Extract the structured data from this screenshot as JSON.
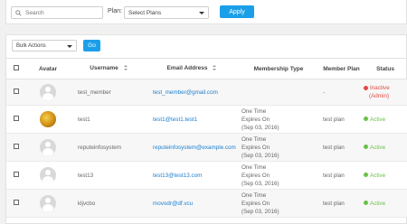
{
  "filter": {
    "search_placeholder": "Search",
    "plan_label": "Plan:",
    "plan_select_value": "Select Plans",
    "apply_label": "Apply"
  },
  "bulk": {
    "select_value": "Bulk Actions",
    "go_label": "Go"
  },
  "table": {
    "headers": {
      "avatar": "Avatar",
      "username": "Username",
      "email": "Email Address",
      "membership_type": "Membership Type",
      "member_plan": "Member Plan",
      "status": "Status"
    },
    "rows": [
      {
        "username": "test_member",
        "email": "test_member@gmail.com",
        "type_line1": "",
        "type_line2": "",
        "type_line3": "",
        "plan": "-",
        "status": "Inactive",
        "status_line2": "(Admin)"
      },
      {
        "username": "test1",
        "email": "test1@test1.test1",
        "type_line1": "One Time",
        "type_line2": "Expires On",
        "type_line3": "(Sep 03, 2016)",
        "plan": "test plan",
        "status": "Active",
        "status_line2": ""
      },
      {
        "username": "reputeinfosystem",
        "email": "reputeinfosystem@example.com",
        "type_line1": "One Time",
        "type_line2": "Expires On",
        "type_line3": "(Sep 03, 2016)",
        "plan": "test plan",
        "status": "Active",
        "status_line2": ""
      },
      {
        "username": "test13",
        "email": "test13@test13.com",
        "type_line1": "One Time",
        "type_line2": "Expires On",
        "type_line3": "(Sep 03, 2016)",
        "plan": "test plan",
        "status": "Active",
        "status_line2": ""
      },
      {
        "username": "kljvcbo",
        "email": "movodr@df.vcu",
        "type_line1": "One Time",
        "type_line2": "Expires On",
        "type_line3": "(Sep 03, 2016)",
        "plan": "test plan",
        "status": "Active",
        "status_line2": ""
      }
    ]
  },
  "colors": {
    "accent": "#1c9fe9",
    "active": "#6cc04a",
    "inactive": "#e04a3f",
    "link": "#1b7fcf"
  }
}
